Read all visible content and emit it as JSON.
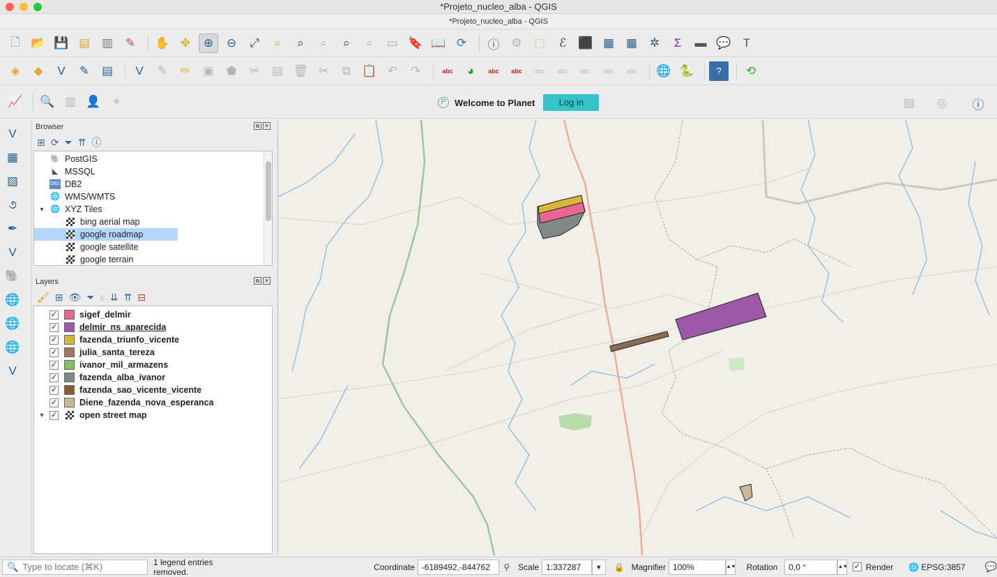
{
  "window": {
    "title": "*Projeto_nucleo_alba - QGIS",
    "subtitle": "*Projeto_nucleo_alba - QGIS"
  },
  "planet": {
    "welcome": "Welcome to Planet",
    "login": "Log in",
    "logo_letter": "P"
  },
  "browser": {
    "title": "Browser",
    "items": [
      {
        "label": "PostGIS",
        "icon": "postgis-icon"
      },
      {
        "label": "MSSQL",
        "icon": "mssql-icon"
      },
      {
        "label": "DB2",
        "icon": "db2-icon"
      },
      {
        "label": "WMS/WMTS",
        "icon": "globe-icon"
      },
      {
        "label": "XYZ Tiles",
        "icon": "globe-icon",
        "expanded": true
      },
      {
        "label": "bing aerial map",
        "icon": "tile-icon",
        "child": true
      },
      {
        "label": "google roadmap",
        "icon": "tile-icon",
        "child": true,
        "selected": true
      },
      {
        "label": "google satellite",
        "icon": "tile-icon",
        "child": true
      },
      {
        "label": "google terrain",
        "icon": "tile-icon",
        "child": true
      }
    ]
  },
  "layers": {
    "title": "Layers",
    "items": [
      {
        "name": "sigef_delmir",
        "color": "#e8668f",
        "checked": true
      },
      {
        "name": "delmir_ns_aparecida",
        "color": "#9b59a8",
        "checked": true,
        "underline": true
      },
      {
        "name": "fazenda_triunfo_vicente",
        "color": "#d9b53a",
        "checked": true
      },
      {
        "name": "julia_santa_tereza",
        "color": "#a9785a",
        "checked": true
      },
      {
        "name": "ivanor_mil_armazens",
        "color": "#86bd6b",
        "checked": true
      },
      {
        "name": "fazenda_alba_ivanor",
        "color": "#7f8a88",
        "checked": true
      },
      {
        "name": "fazenda_sao_vicente_vicente",
        "color": "#8a5a36",
        "checked": true
      },
      {
        "name": "Diene_fazenda_nova_esperanca",
        "color": "#c9b79a",
        "checked": true
      },
      {
        "name": "open street map",
        "color": "",
        "checked": true,
        "tiles": true
      }
    ]
  },
  "status": {
    "locate_placeholder": "Type to locate (⌘K)",
    "message": "1 legend entries removed.",
    "coordinate_label": "Coordinate",
    "coordinate_value": "-6189492,-844762",
    "scale_label": "Scale",
    "scale_value": "1:337287",
    "magnifier_label": "Magnifier",
    "magnifier_value": "100%",
    "rotation_label": "Rotation",
    "rotation_value": "0,0 °",
    "render_label": "Render",
    "crs": "EPSG:3857"
  }
}
